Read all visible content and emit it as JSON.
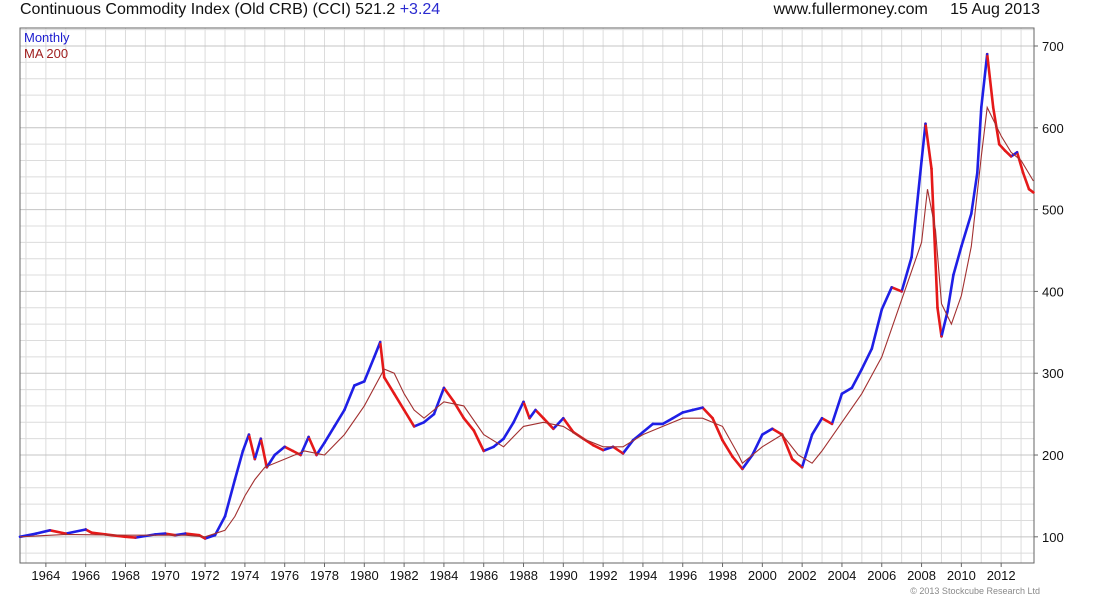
{
  "header": {
    "title": "Continuous Commodity Index (Old CRB) (CCI) 521.2",
    "change": "+3.24",
    "site": "www.fullermoney.com",
    "date": "15 Aug 2013"
  },
  "legend": {
    "series_a": "Monthly",
    "series_b": "MA 200"
  },
  "copyright": "© 2013 Stockcube Research Ltd",
  "colors": {
    "up": "#1f1fe6",
    "down": "#e51919",
    "ma": "#a23030",
    "grid": "#dcdcdc",
    "axis": "#666666"
  },
  "chart_data": {
    "type": "line",
    "title": "Continuous Commodity Index (Old CRB) (CCI) 521.2",
    "xlim": [
      1962.7,
      2013.65
    ],
    "ylim": [
      68,
      722
    ],
    "y_axis_position": "right",
    "grid": true,
    "legend_position": "top-left",
    "x_ticks": [
      1964,
      1966,
      1968,
      1970,
      1972,
      1974,
      1976,
      1978,
      1980,
      1982,
      1984,
      1986,
      1988,
      1990,
      1992,
      1994,
      1996,
      1998,
      2000,
      2002,
      2004,
      2006,
      2008,
      2010,
      2012
    ],
    "y_ticks": [
      100,
      200,
      300,
      400,
      500,
      600,
      700
    ],
    "series": [
      {
        "name": "Monthly",
        "x": [
          1962.7,
          1963.5,
          1964.2,
          1965.0,
          1966.0,
          1966.3,
          1967.0,
          1968.0,
          1968.5,
          1969.5,
          1970.0,
          1970.5,
          1971.0,
          1971.7,
          1972.0,
          1972.5,
          1973.0,
          1973.5,
          1973.9,
          1974.2,
          1974.5,
          1974.8,
          1975.1,
          1975.5,
          1976.0,
          1976.4,
          1976.8,
          1977.2,
          1977.6,
          1978.0,
          1978.5,
          1979.0,
          1979.5,
          1980.0,
          1980.5,
          1980.8,
          1981.0,
          1981.5,
          1982.0,
          1982.5,
          1983.0,
          1983.5,
          1984.0,
          1984.5,
          1985.0,
          1985.5,
          1986.0,
          1986.5,
          1987.0,
          1987.5,
          1988.0,
          1988.3,
          1988.6,
          1989.0,
          1989.5,
          1990.0,
          1990.5,
          1991.0,
          1991.5,
          1992.0,
          1992.5,
          1993.0,
          1993.5,
          1994.0,
          1994.5,
          1995.0,
          1995.5,
          1996.0,
          1996.5,
          1997.0,
          1997.5,
          1998.0,
          1998.5,
          1999.0,
          1999.5,
          2000.0,
          2000.5,
          2001.0,
          2001.5,
          2002.0,
          2002.5,
          2003.0,
          2003.5,
          2004.0,
          2004.5,
          2005.0,
          2005.5,
          2006.0,
          2006.5,
          2007.0,
          2007.5,
          2008.0,
          2008.2,
          2008.5,
          2008.8,
          2009.0,
          2009.3,
          2009.6,
          2010.0,
          2010.5,
          2010.8,
          2011.0,
          2011.3,
          2011.6,
          2011.9,
          2012.2,
          2012.5,
          2012.8,
          2013.1,
          2013.4,
          2013.62
        ],
        "values": [
          100,
          104,
          108,
          104,
          109,
          105,
          103,
          100,
          99,
          103,
          104,
          102,
          104,
          102,
          98,
          102,
          125,
          170,
          205,
          225,
          195,
          220,
          185,
          200,
          210,
          205,
          200,
          222,
          200,
          215,
          235,
          255,
          285,
          290,
          320,
          338,
          295,
          275,
          255,
          235,
          240,
          250,
          282,
          265,
          245,
          230,
          205,
          210,
          220,
          240,
          265,
          245,
          255,
          245,
          232,
          245,
          228,
          220,
          212,
          206,
          210,
          202,
          218,
          228,
          238,
          238,
          245,
          252,
          255,
          258,
          245,
          218,
          198,
          183,
          200,
          225,
          232,
          225,
          195,
          185,
          225,
          245,
          238,
          275,
          282,
          305,
          330,
          378,
          405,
          400,
          442,
          560,
          605,
          550,
          380,
          345,
          375,
          420,
          455,
          495,
          545,
          625,
          690,
          625,
          580,
          572,
          565,
          570,
          545,
          525,
          521
        ]
      },
      {
        "name": "MA 200",
        "x": [
          1962.7,
          1965.0,
          1968.0,
          1971.0,
          1972.0,
          1973.0,
          1973.5,
          1974.0,
          1974.5,
          1975.0,
          1976.0,
          1977.0,
          1978.0,
          1979.0,
          1980.0,
          1981.0,
          1981.5,
          1982.0,
          1982.5,
          1983.0,
          1984.0,
          1985.0,
          1986.0,
          1987.0,
          1988.0,
          1989.0,
          1990.0,
          1991.0,
          1992.0,
          1993.0,
          1994.0,
          1995.0,
          1996.0,
          1997.0,
          1998.0,
          1998.8,
          1999.0,
          2000.0,
          2001.0,
          2001.8,
          2002.5,
          2003.0,
          2004.0,
          2005.0,
          2006.0,
          2007.0,
          2008.0,
          2008.3,
          2008.7,
          2009.0,
          2009.5,
          2010.0,
          2010.5,
          2011.0,
          2011.3,
          2012.0,
          2012.5,
          2013.0,
          2013.62
        ],
        "values": [
          100,
          103,
          102,
          102,
          100,
          108,
          125,
          150,
          170,
          185,
          195,
          205,
          200,
          225,
          260,
          305,
          300,
          275,
          255,
          245,
          265,
          260,
          225,
          210,
          235,
          240,
          235,
          220,
          210,
          210,
          225,
          235,
          245,
          245,
          235,
          200,
          190,
          210,
          225,
          200,
          190,
          205,
          240,
          275,
          320,
          390,
          460,
          525,
          475,
          385,
          360,
          395,
          455,
          565,
          625,
          590,
          570,
          560,
          535
        ]
      }
    ]
  }
}
